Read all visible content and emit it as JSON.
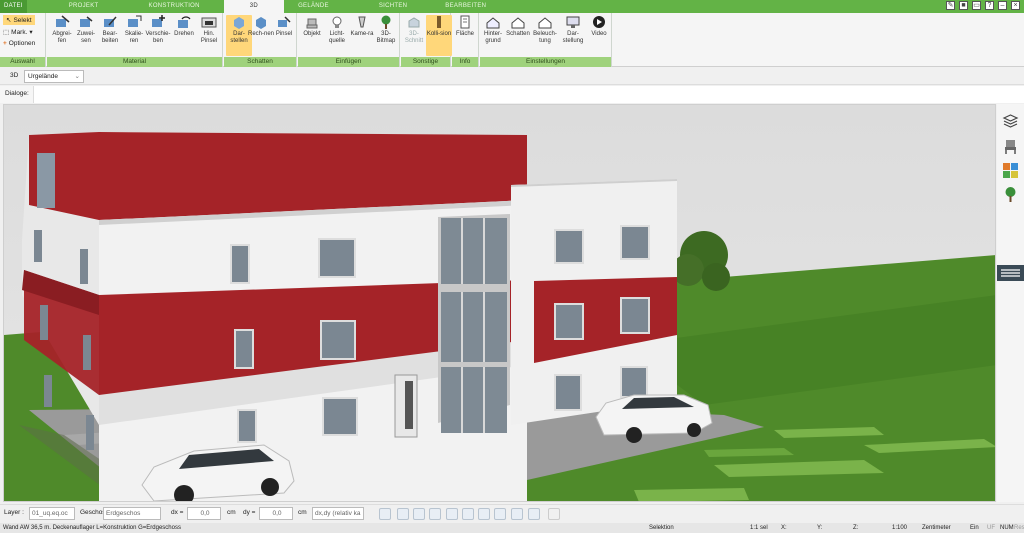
{
  "tabs": [
    "DATEI",
    "PROJEKT",
    "KONSTRUKTION",
    "3D",
    "GELÄNDE",
    "SICHTEN",
    "BEARBEITEN"
  ],
  "ribbon": {
    "auswahl": {
      "select": "Selekt",
      "mark": "Mark.",
      "options": "Optionen",
      "label": "Auswahl"
    },
    "material": {
      "label": "Material",
      "buttons": [
        "Abgrei-fen",
        "Zuwei-sen",
        "Bear-beiten",
        "Skalie-ren",
        "Verschie-ben",
        "Drehen",
        "Hin. Pinsel"
      ]
    },
    "schatten": {
      "label": "Schatten",
      "buttons": [
        "Dar-stellen",
        "Rech-nen",
        "Pinsel"
      ]
    },
    "einfuegen": {
      "label": "Einfügen",
      "buttons": [
        "Objekt",
        "Licht-quelle",
        "Kame-ra",
        "3D-Bitmap"
      ]
    },
    "sonstige": {
      "label": "Sonstige",
      "buttons": [
        "3D-Schnitt",
        "Kolli-sion"
      ]
    },
    "info": {
      "label": "Info",
      "buttons": [
        "Fläche"
      ]
    },
    "einstellungen": {
      "label": "Einstellungen",
      "buttons": [
        "Hinter-grund",
        "Schatten",
        "Beleuch-tung",
        "Dar-stellung",
        "Video"
      ]
    }
  },
  "viewbar": {
    "mode": "3D",
    "terrain": "Urgelände"
  },
  "dialog": {
    "label": "Dialoge:"
  },
  "bottom": {
    "layer_label": "Layer :",
    "layer_value": "01_uq.eq.oc",
    "floor_label": "Geschoss :",
    "floor_value": "Erdgeschos",
    "dx_label": "dx =",
    "dx_value": "0,0",
    "dx_unit": "cm",
    "dy_label": "dy =",
    "dy_value": "0,0",
    "dy_unit": "cm",
    "mode_value": "dx,dy (relativ ka"
  },
  "status": {
    "text": "Wand AW 36,5 m. Deckenauflager L=Konstruktion G=Erdgeschoss",
    "mode": "Selektion",
    "ratio": "1:1 sel",
    "x": "X:",
    "y": "Y:",
    "z": "Z:",
    "scale": "1:100",
    "unit": "Zentimeter",
    "on": "Ein",
    "uf": "UF",
    "num": "NUM",
    "res": "Res"
  },
  "colors": {
    "green": "#63b346",
    "red": "#a52328",
    "wall": "#f2f2f2",
    "lawn": "#4f8a2a"
  }
}
